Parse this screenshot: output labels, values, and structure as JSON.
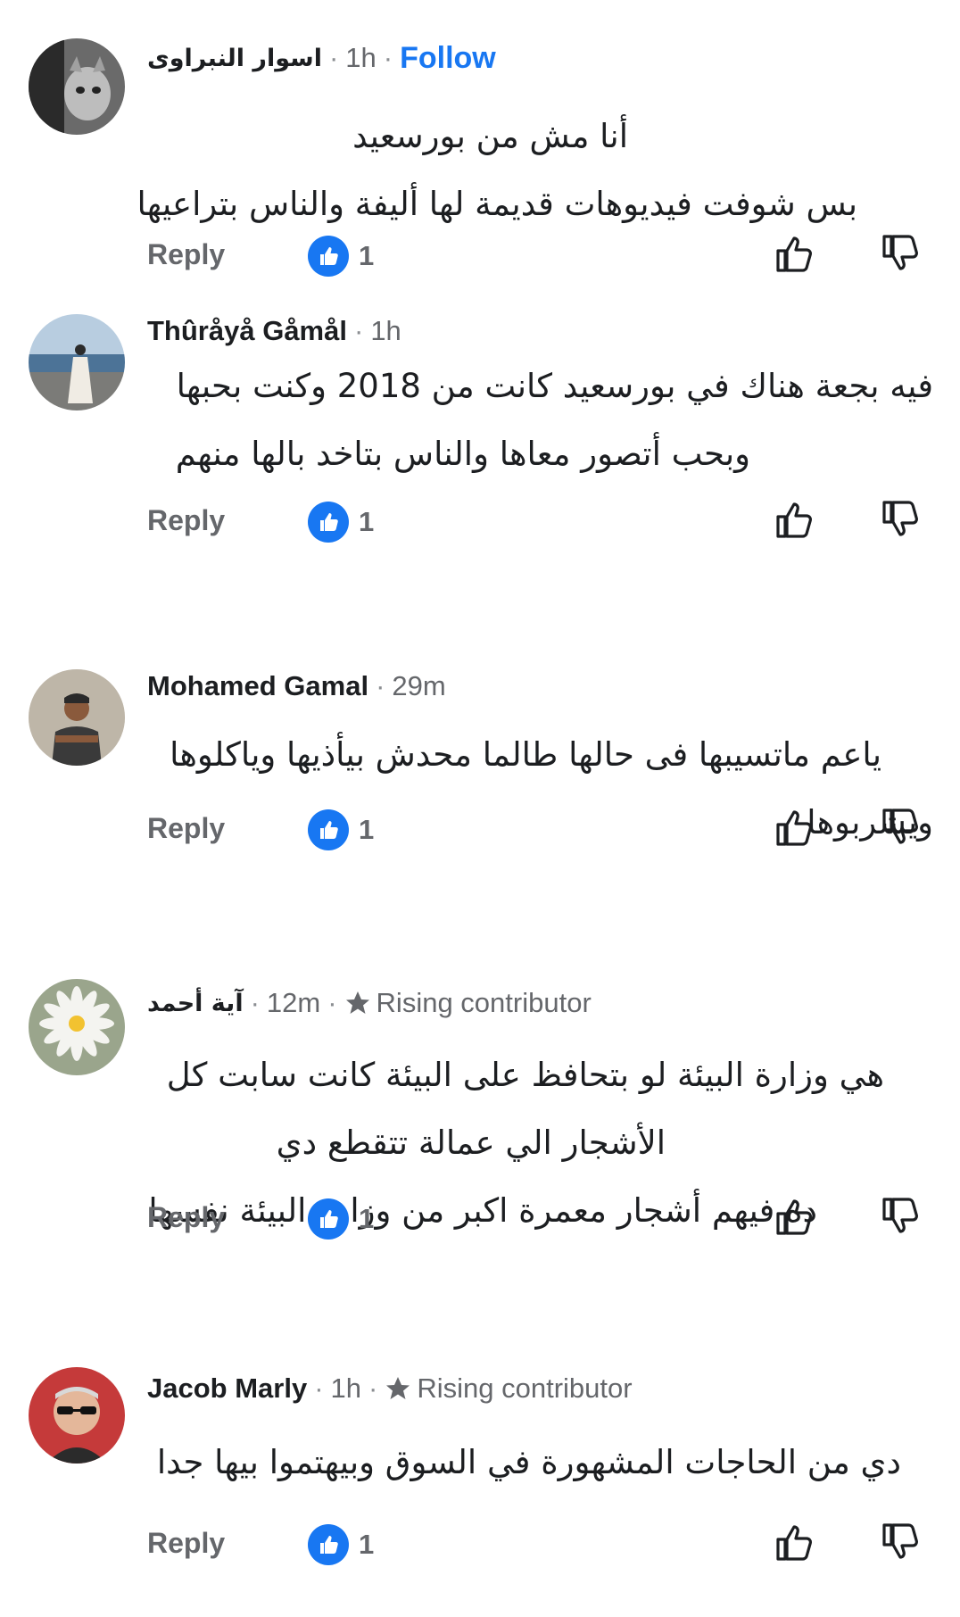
{
  "reply_label": "Reply",
  "colors": {
    "accent": "#1877f2",
    "secondary_text": "#65676b",
    "primary_text": "#1c1e21"
  },
  "comments": [
    {
      "author": "اسوار النبراوى",
      "time": "1h",
      "follow_label": "Follow",
      "avatar_icon": "cat-avatar",
      "lines": [
        "أنا مش من بورسعيد",
        "بس شوفت فيديوهات قديمة لها أليفة والناس بتراعيها"
      ],
      "likes": "1"
    },
    {
      "author": "Thûråyå Gåmål",
      "time": "1h",
      "avatar_icon": "seaside-avatar",
      "lines": [
        "فيه بجعة هناك في بورسعيد كانت من 2018 وكنت بحبها",
        "وبحب أتصور معاها والناس بتاخد بالها منهم"
      ],
      "likes": "1"
    },
    {
      "author": "Mohamed Gamal",
      "time": "29m",
      "avatar_icon": "person-avatar",
      "lines": [
        "ياعم ماتسيبها فى حالها طالما محدش بيأذيها وياكلوها",
        "ويشربوها"
      ],
      "likes": "1"
    },
    {
      "author": "آية أحمد",
      "time": "12m",
      "badge": "Rising contributor",
      "avatar_icon": "flower-avatar",
      "lines": [
        "هي وزارة البيئة لو بتحافظ على البيئة كانت سابت كل",
        "الأشجار الي عمالة تتقطع دي",
        "ده فيهم أشجار معمرة اكبر من وزارة البيئة نفسها"
      ],
      "likes": "1"
    },
    {
      "author": "Jacob Marly",
      "time": "1h",
      "badge": "Rising contributor",
      "avatar_icon": "man-sunglasses-avatar",
      "lines": [
        "دي من الحاجات المشهورة في السوق وبيهتموا بيها جدا"
      ],
      "likes": "1"
    }
  ]
}
